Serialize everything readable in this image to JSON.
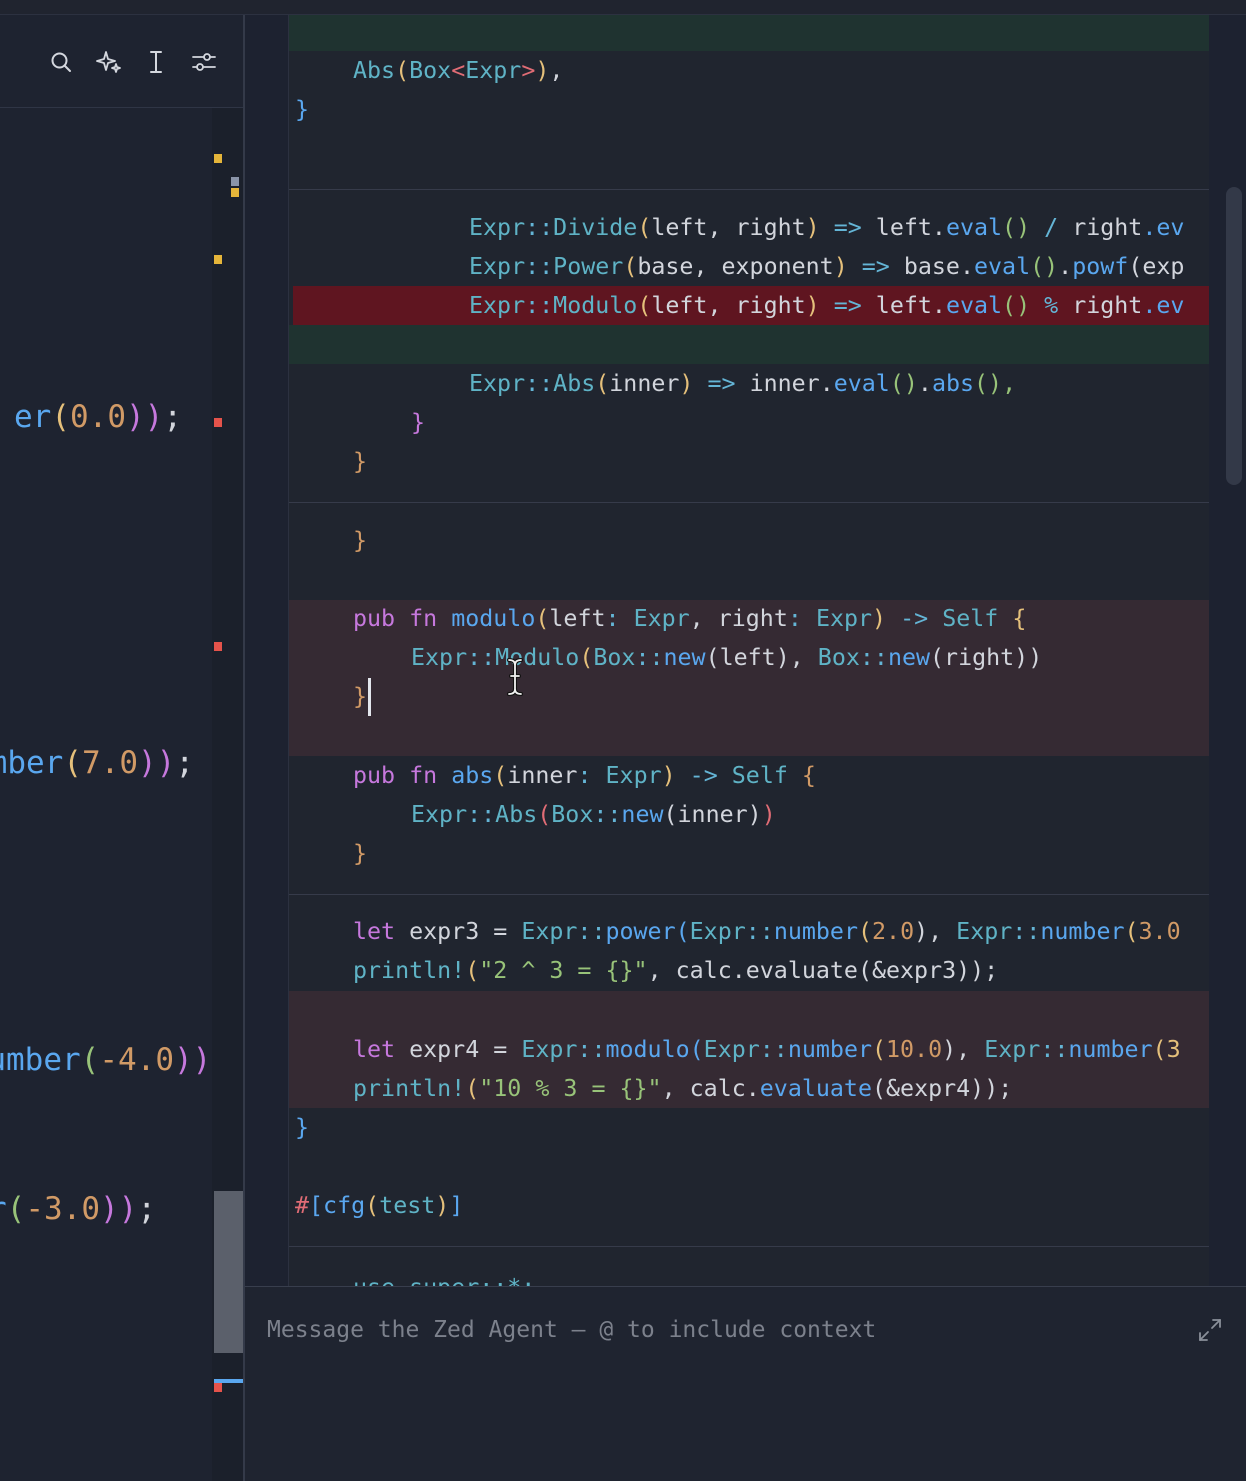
{
  "left_editor": {
    "toolbar": {
      "icons": [
        "search-icon",
        "sparkle-icon",
        "text-cursor-icon",
        "sliders-icon"
      ]
    },
    "lines": [
      {
        "pre": "er",
        "open": "(",
        "num": "0.0",
        "close": "))",
        "semi": ";"
      },
      {
        "pre": "mber",
        "open": "(",
        "num": "7.0",
        "close": "))",
        "semi": ";"
      },
      {
        "pre": "umber",
        "open": "(",
        "num": "-4.0",
        "close": "))",
        "semi": ";"
      },
      {
        "pre": "r",
        "open": "(",
        "num": "-3.0",
        "close": "))",
        "semi": ";"
      }
    ],
    "gutter_markers": [
      {
        "kind": "modified",
        "color": "#e5b53a"
      },
      {
        "kind": "modified",
        "color": "#8a94a8"
      },
      {
        "kind": "modified",
        "color": "#e5b53a"
      },
      {
        "kind": "modified",
        "color": "#e5b53a"
      },
      {
        "kind": "error",
        "color": "#e5534b"
      },
      {
        "kind": "error",
        "color": "#e5534b"
      },
      {
        "kind": "error",
        "color": "#e5534b"
      }
    ]
  },
  "agent_panel": {
    "diff_lines": {
      "l1": {
        "a": "Abs",
        "b": "(",
        "c": "Box",
        "d": "<",
        "e": "Expr",
        "f": ">",
        "g": ")",
        "h": ","
      },
      "l2": "}",
      "l3": {
        "a": "Expr",
        "b": "::",
        "c": "Divide",
        "d": "(",
        "e": "left, right",
        "f": ")",
        "g": " => ",
        "h": "left",
        "i": ".",
        "j": "eval",
        "k": "()",
        "l": " / ",
        "m": "right",
        "n": ".ev"
      },
      "l4": {
        "a": "Expr",
        "b": "::",
        "c": "Power",
        "d": "(",
        "e": "base, exponent",
        "f": ")",
        "g": " => ",
        "h": "base",
        "i": ".",
        "j": "eval",
        "k": "()",
        "l": ".",
        "m": "powf",
        "n": "(exp"
      },
      "l5": {
        "a": "Expr",
        "b": "::",
        "c": "Modulo",
        "d": "(",
        "e": "left, right",
        "f": ")",
        "g": " => ",
        "h": "left",
        "i": ".",
        "j": "eval",
        "k": "()",
        "l": " % ",
        "m": "right",
        "n": ".ev"
      },
      "l6": {
        "a": "Expr",
        "b": "::",
        "c": "Abs",
        "d": "(",
        "e": "inner",
        "f": ")",
        "g": " => ",
        "h": "inner",
        "i": ".",
        "j": "eval",
        "k": "()",
        "l": ".",
        "m": "abs",
        "n": "(),"
      },
      "l7": "}",
      "l8": "}",
      "l9": "}",
      "l10": {
        "a": "pub",
        "b": "fn",
        "c": "modulo",
        "d": "(",
        "e": "left",
        "f": ": ",
        "g": "Expr",
        "h": ", ",
        "i": "right",
        "j": ": ",
        "k": "Expr",
        "l": ")",
        "m": " -> ",
        "n": "Self",
        "o": " {"
      },
      "l11": {
        "a": "Expr",
        "b": "::",
        "c": "Modulo",
        "d": "(",
        "e": "Box",
        "f": "::",
        "g": "new",
        "h": "(left), ",
        "i": "Box",
        "j": "::",
        "k": "new",
        "l": "(right))"
      },
      "l12": "}",
      "l13": {
        "a": "pub",
        "b": "fn",
        "c": "abs",
        "d": "(",
        "e": "inner",
        "f": ": ",
        "g": "Expr",
        "h": ")",
        "i": " -> ",
        "j": "Self",
        "k": " {"
      },
      "l14": {
        "a": "Expr",
        "b": "::",
        "c": "Abs",
        "d": "(",
        "e": "Box",
        "f": "::",
        "g": "new",
        "h": "(inner)",
        "i": ")"
      },
      "l15": "}",
      "l16": {
        "a": "let",
        "b": " expr3 = ",
        "c": "Expr",
        "d": "::",
        "e": "power",
        "f": "(",
        "g": "Expr",
        "h": "::",
        "i": "number",
        "j": "(",
        "k": "2.0",
        "l": "), ",
        "m": "Expr",
        "n": "::",
        "o": "number",
        "p": "(",
        "q": "3.0"
      },
      "l17": {
        "a": "println!",
        "b": "(",
        "c": "\"2 ^ 3 = {}\"",
        "d": ", calc.evaluate(&expr3));"
      },
      "l18": {
        "a": "let",
        "b": " expr4 = ",
        "c": "Expr",
        "d": "::",
        "e": "modulo",
        "f": "(",
        "g": "Expr",
        "h": "::",
        "i": "number",
        "j": "(",
        "k": "10.0",
        "l": "), ",
        "m": "Expr",
        "n": "::",
        "o": "number",
        "p": "(3"
      },
      "l19": {
        "a": "println!",
        "b": "(",
        "c": "\"10 % 3 = {}\"",
        "d": ", calc.",
        "e": "evaluate",
        "f": "(&expr4));"
      },
      "l20": "}",
      "l21": {
        "a": "#",
        "b": "[cfg",
        "c": "(",
        "d": "test",
        "e": ")",
        "f": "]"
      },
      "l22": "use super::*;"
    },
    "input": {
      "placeholder": "Message the Zed Agent — @ to include context"
    },
    "colors": {
      "added_band": "#1f3330",
      "removed_line": "#5f1520",
      "hunk_band": "#352a33"
    }
  }
}
